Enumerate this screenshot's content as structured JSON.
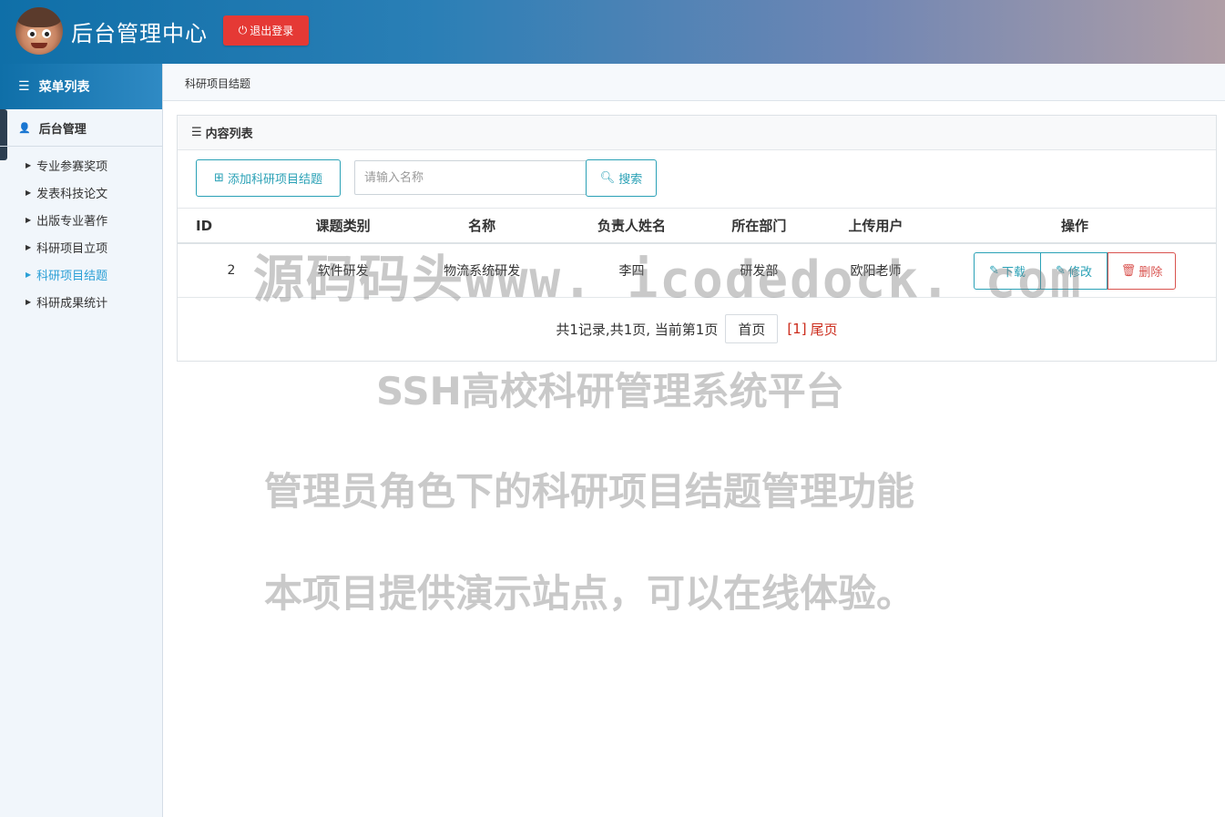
{
  "header": {
    "title": "后台管理中心",
    "logout_label": "退出登录"
  },
  "sidebar": {
    "menu_title": "菜单列表",
    "group_title": "后台管理",
    "items": [
      {
        "label": "专业参赛奖项"
      },
      {
        "label": "发表科技论文"
      },
      {
        "label": "出版专业著作"
      },
      {
        "label": "科研项目立项"
      },
      {
        "label": "科研项目结题",
        "active": true
      },
      {
        "label": "科研成果统计"
      }
    ]
  },
  "breadcrumb": {
    "current": "科研项目结题"
  },
  "panel": {
    "title": "内容列表",
    "add_label": "添加科研项目结题",
    "search_placeholder": "请输入名称",
    "search_label": "搜索"
  },
  "table": {
    "headers": [
      "ID",
      "课题类别",
      "名称",
      "负责人姓名",
      "所在部门",
      "上传用户",
      "操作"
    ],
    "rows": [
      {
        "id": "2",
        "category": "软件研发",
        "name": "物流系统研发",
        "owner": "李四",
        "dept": "研发部",
        "user": "欧阳老师"
      }
    ],
    "actions": {
      "download": "下载",
      "edit": "修改",
      "delete": "删除"
    }
  },
  "pagination": {
    "summary": "共1记录,共1页, 当前第1页",
    "first": "首页",
    "current": "[1]",
    "last": "尾页"
  },
  "watermarks": [
    "源码码头www. icodedock. com",
    "SSH高校科研管理系统平台",
    "管理员角色下的科研项目结题管理功能",
    "本项目提供演示站点，可以在线体验。"
  ],
  "colors": {
    "header_start": "#0f6fa8",
    "logout": "#e53935",
    "accent": "#2aa1b6",
    "danger": "#d9534f",
    "active_link": "#2a9fd6"
  }
}
